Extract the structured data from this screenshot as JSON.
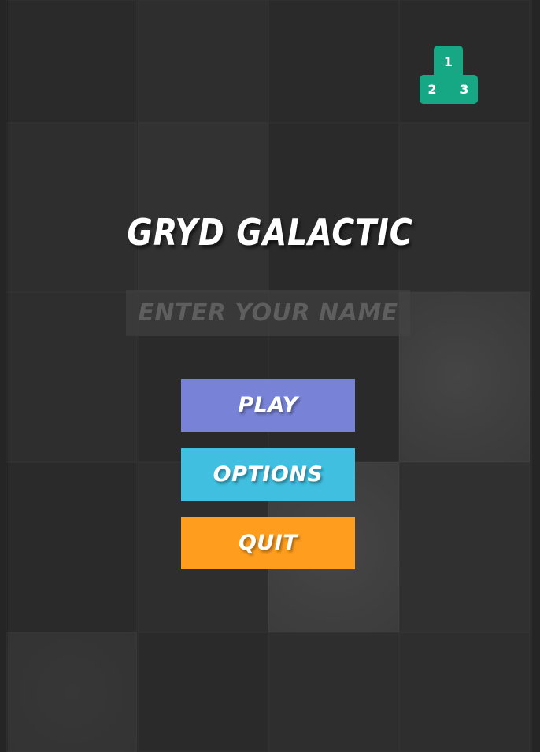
{
  "game": {
    "title": "GRYD GALACTIC"
  },
  "leaderboard": {
    "first": "1",
    "second": "2",
    "third": "3",
    "color": "#16a784"
  },
  "name_field": {
    "value": "",
    "placeholder": "ENTER YOUR NAME"
  },
  "menu": {
    "play_label": "PLAY",
    "options_label": "OPTIONS",
    "quit_label": "QUIT",
    "play_color": "#7883d8",
    "options_color": "#40bfe0",
    "quit_color": "#ff9e1e"
  },
  "background": {
    "description_colors": [
      "#2a2a2a",
      "#2e2e2e",
      "#323232",
      "#3e3e3e"
    ]
  }
}
